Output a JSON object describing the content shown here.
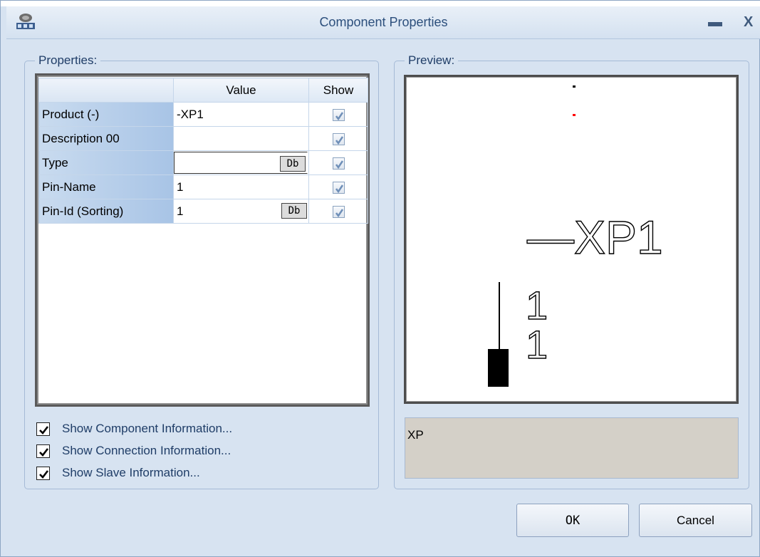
{
  "window": {
    "title": "Component Properties",
    "minimize_symbol": "▬",
    "close_symbol": "X",
    "icon": "app-logo-icon"
  },
  "properties": {
    "legend": "Properties:",
    "columns": [
      "",
      "Value",
      "Show"
    ],
    "rows": [
      {
        "name": "Product (-)",
        "value": "-XP1",
        "show": true,
        "has_db": false
      },
      {
        "name": "Description 00",
        "value": "",
        "show": true,
        "has_db": false
      },
      {
        "name": "Type",
        "value": "",
        "show": true,
        "has_db": true
      },
      {
        "name": "Pin-Name",
        "value": "1",
        "show": true,
        "has_db": false
      },
      {
        "name": "Pin-Id (Sorting)",
        "value": "1",
        "show": true,
        "has_db": true
      }
    ],
    "db_label": "Db"
  },
  "options": [
    {
      "label": "Show Component Information...",
      "checked": true
    },
    {
      "label": "Show Connection Information...",
      "checked": true
    },
    {
      "label": "Show Slave Information...",
      "checked": true
    }
  ],
  "preview": {
    "legend": "Preview:",
    "component_label": "—XP1",
    "pin_labels": [
      "1",
      "1"
    ],
    "code": "XP"
  },
  "buttons": {
    "ok": "OK",
    "cancel": "Cancel"
  },
  "colors": {
    "accent_text": "#1f3d67",
    "header_blue": "#a8c4e6",
    "marker_red": "#ff0000"
  }
}
